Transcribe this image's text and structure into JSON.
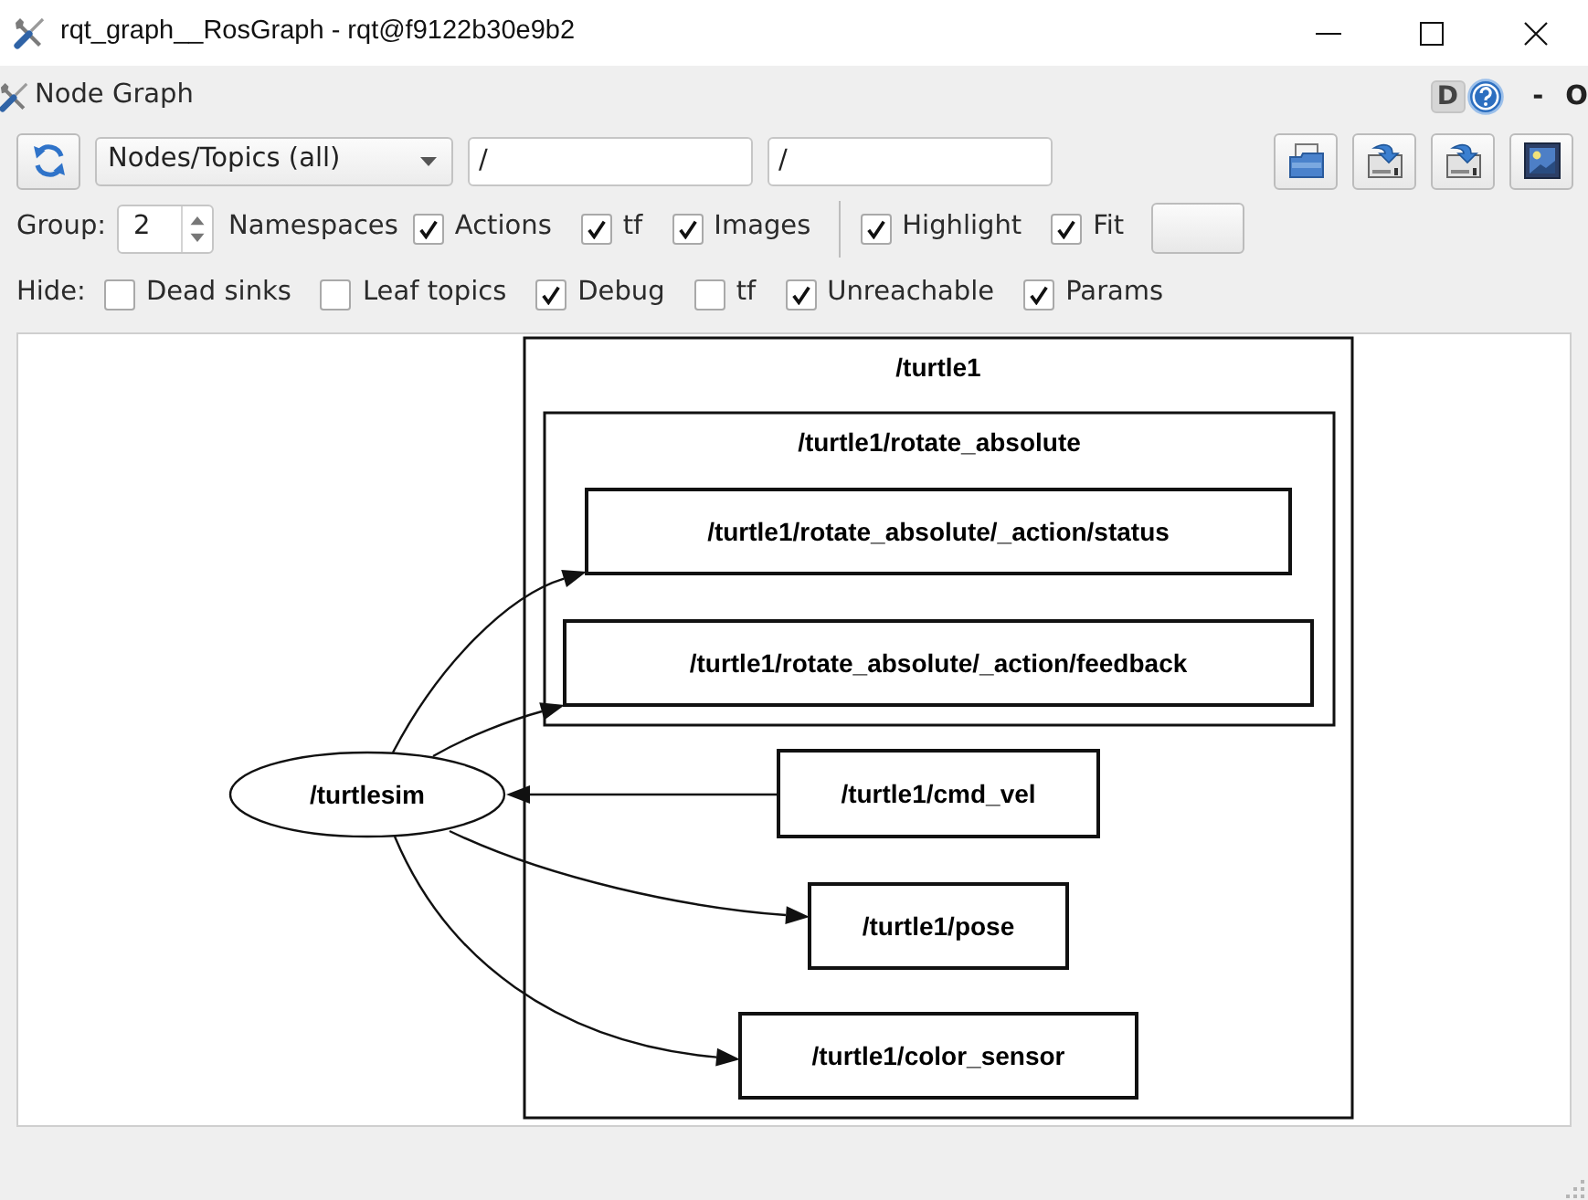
{
  "window": {
    "title": "rqt_graph__RosGraph - rqt@f9122b30e9b2"
  },
  "plugin_bar": {
    "title": "Node Graph",
    "buttons": [
      {
        "kind": "dock",
        "label": "D"
      },
      {
        "kind": "help"
      },
      {
        "kind": "text",
        "label": "-"
      },
      {
        "kind": "text",
        "label": "O"
      }
    ]
  },
  "toolbar": {
    "mode": "Nodes/Topics (all)",
    "filters": [
      {
        "value": "/"
      },
      {
        "value": "/"
      }
    ]
  },
  "options": {
    "group_label": "Group:",
    "group_value": "2",
    "items": [
      {
        "kind": "label",
        "label": "Namespaces"
      },
      {
        "kind": "checkbox",
        "label": "Actions",
        "checked": true
      },
      {
        "kind": "checkbox",
        "label": "tf",
        "checked": true
      },
      {
        "kind": "checkbox",
        "label": "Images",
        "checked": true
      },
      {
        "kind": "separator"
      },
      {
        "kind": "checkbox",
        "label": "Highlight",
        "checked": true
      },
      {
        "kind": "checkbox",
        "label": "Fit",
        "checked": true
      },
      {
        "kind": "button"
      }
    ]
  },
  "hide": {
    "label": "Hide:",
    "items": [
      {
        "label": "Dead sinks",
        "checked": false
      },
      {
        "label": "Leaf topics",
        "checked": false
      },
      {
        "label": "Debug",
        "checked": true
      },
      {
        "label": "tf",
        "checked": false
      },
      {
        "label": "Unreachable",
        "checked": true
      },
      {
        "label": "Params",
        "checked": true
      }
    ]
  },
  "graph": {
    "nodes": [
      {
        "kind": "node",
        "label": "/turtlesim"
      },
      {
        "kind": "cluster",
        "label": "/turtle1",
        "children": [
          {
            "kind": "cluster",
            "label": "/turtle1/rotate_absolute",
            "children": [
              {
                "kind": "topic",
                "label": "/turtle1/rotate_absolute/_action/status",
                "subscribed": false
              },
              {
                "kind": "topic",
                "label": "/turtle1/rotate_absolute/_action/feedback",
                "subscribed": false
              }
            ]
          },
          {
            "kind": "topic",
            "label": "/turtle1/cmd_vel",
            "subscribed": true
          },
          {
            "kind": "topic",
            "label": "/turtle1/pose",
            "subscribed": false
          },
          {
            "kind": "topic",
            "label": "/turtle1/color_sensor",
            "subscribed": false
          }
        ]
      }
    ]
  }
}
